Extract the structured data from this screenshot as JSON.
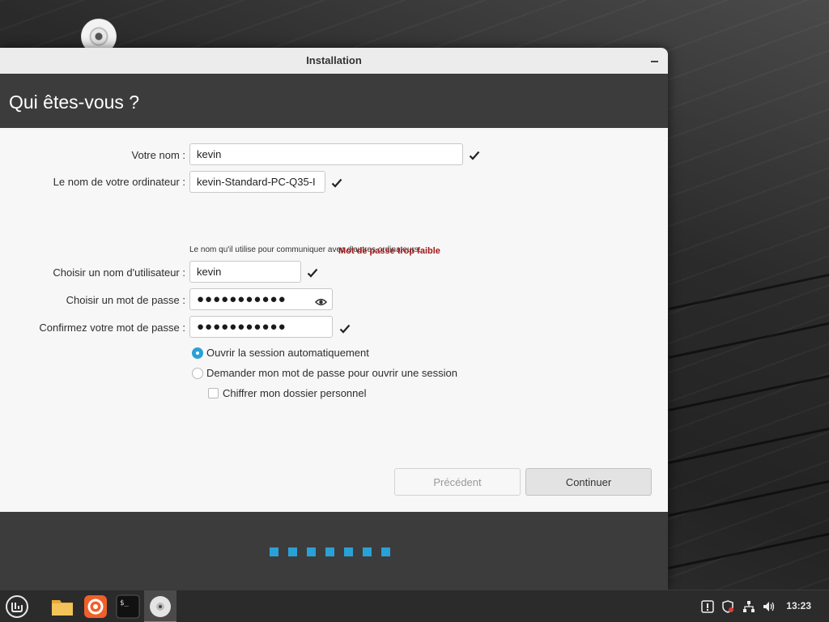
{
  "window": {
    "title": "Installation"
  },
  "page": {
    "heading": "Qui êtes-vous ?"
  },
  "form": {
    "name": {
      "label": "Votre nom :",
      "value": "kevin"
    },
    "computer": {
      "label": "Le nom de votre ordinateur :",
      "value": "kevin-Standard-PC-Q35-I",
      "hint": "Le nom qu'il utilise pour communiquer avec d'autres ordinateurs."
    },
    "username": {
      "label": "Choisir un nom d'utilisateur :",
      "value": "kevin"
    },
    "password": {
      "label": "Choisir un mot de passe :",
      "masked": "●●●●●●●●●●●",
      "warning": "Mot de passe trop faible"
    },
    "confirm": {
      "label": "Confirmez votre mot de passe :",
      "masked": "●●●●●●●●●●●"
    },
    "login_options": [
      {
        "label": "Ouvrir la session automatiquement",
        "selected": true
      },
      {
        "label": "Demander mon mot de passe pour ouvrir une session",
        "selected": false
      }
    ],
    "encrypt_home": {
      "label": "Chiffrer mon dossier personnel",
      "checked": false
    }
  },
  "buttons": {
    "previous": "Précédent",
    "continue": "Continuer"
  },
  "progress": {
    "steps": 7
  },
  "taskbar": {
    "apps": [
      "menu-icon",
      "files-icon",
      "firefox-icon",
      "terminal-icon",
      "installer-disc-icon"
    ],
    "tray": [
      "update-icon",
      "shield-icon",
      "network-icon",
      "volume-icon"
    ],
    "clock": "13:23"
  },
  "colors": {
    "accent": "#2aa1d6",
    "warning": "#a01818",
    "header": "#3c3c3c"
  }
}
